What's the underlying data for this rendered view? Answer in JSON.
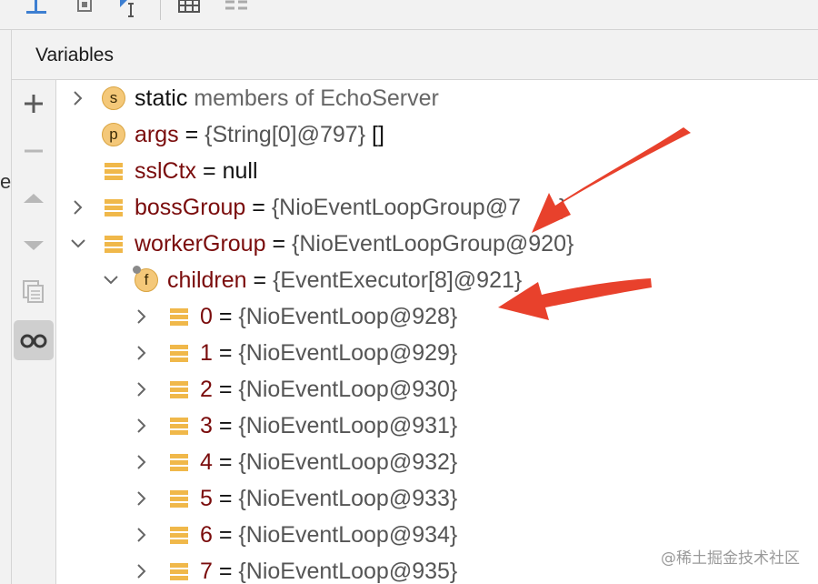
{
  "panel": {
    "title": "Variables"
  },
  "left_edge": {
    "glyph": "e"
  },
  "toolbar": {
    "icons": [
      "step-into-icon",
      "run-to-cursor-icon",
      "evaluate-icon",
      "table-icon",
      "layout-icon"
    ]
  },
  "sidebar": {
    "buttons": [
      {
        "name": "add-watch-button",
        "icon": "plus-icon",
        "enabled": true
      },
      {
        "name": "remove-watch-button",
        "icon": "minus-icon",
        "enabled": false
      },
      {
        "name": "move-up-button",
        "icon": "triangle-up-icon",
        "enabled": false
      },
      {
        "name": "move-down-button",
        "icon": "triangle-down-icon",
        "enabled": false
      },
      {
        "name": "copy-button",
        "icon": "copy-icon",
        "enabled": false
      },
      {
        "name": "show-watches-button",
        "icon": "glasses-icon",
        "enabled": true,
        "active": true
      }
    ]
  },
  "tree": {
    "static_row": {
      "label": "static",
      "rest": "members of EchoServer",
      "badge": "s"
    },
    "args": {
      "badge": "p",
      "name": "args",
      "eq": "=",
      "type": "{String[0]@797}",
      "value": "[]"
    },
    "sslctx": {
      "name": "sslCtx",
      "eq": "=",
      "value": "null"
    },
    "bossgroup": {
      "name": "bossGroup",
      "eq": "=",
      "type": "{NioEventLoopGroup@7",
      "type_end": "}"
    },
    "workergroup": {
      "name": "workerGroup",
      "eq": "=",
      "type": "{NioEventLoopGroup@920}"
    },
    "children": {
      "badge": "f",
      "name": "children",
      "eq": "=",
      "type": "{EventExecutor[8]@921}"
    },
    "items": [
      {
        "index": "0",
        "eq": "=",
        "type": "{NioEventLoop@928}"
      },
      {
        "index": "1",
        "eq": "=",
        "type": "{NioEventLoop@929}"
      },
      {
        "index": "2",
        "eq": "=",
        "type": "{NioEventLoop@930}"
      },
      {
        "index": "3",
        "eq": "=",
        "type": "{NioEventLoop@931}"
      },
      {
        "index": "4",
        "eq": "=",
        "type": "{NioEventLoop@932}"
      },
      {
        "index": "5",
        "eq": "=",
        "type": "{NioEventLoop@933}"
      },
      {
        "index": "6",
        "eq": "=",
        "type": "{NioEventLoop@934}"
      },
      {
        "index": "7",
        "eq": "=",
        "type": "{NioEventLoop@935}"
      }
    ]
  },
  "watermark": "@稀土掘金技术社区",
  "colors": {
    "annotation_arrow": "#e8412c",
    "field_badge": "#f4c879",
    "var_name": "#7a0c0c"
  }
}
